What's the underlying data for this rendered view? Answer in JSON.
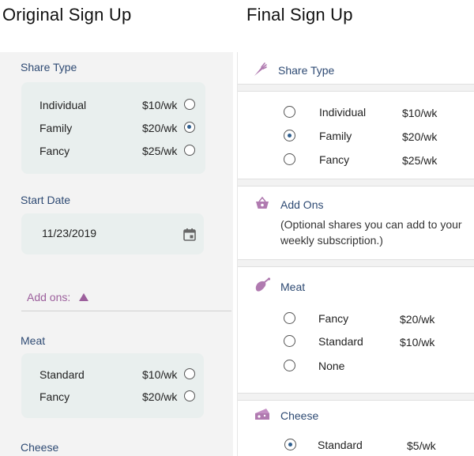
{
  "headings": {
    "original": "Original Sign Up",
    "final": "Final  Sign Up"
  },
  "original": {
    "share_type": {
      "label": "Share Type",
      "options": [
        {
          "name": "Individual",
          "price": "$10/wk",
          "selected": false
        },
        {
          "name": "Family",
          "price": "$20/wk",
          "selected": true
        },
        {
          "name": "Fancy",
          "price": "$25/wk",
          "selected": false
        }
      ]
    },
    "start_date": {
      "label": "Start Date",
      "value": "11/23/2019",
      "icon": "calendar-icon"
    },
    "addons_toggle": {
      "label": "Add ons:",
      "icon": "caret-up-icon"
    },
    "meat": {
      "label": "Meat",
      "options": [
        {
          "name": "Standard",
          "price": "$10/wk",
          "selected": false
        },
        {
          "name": "Fancy",
          "price": "$20/wk",
          "selected": false
        }
      ]
    },
    "cheese": {
      "label": "Cheese"
    }
  },
  "final": {
    "share_type": {
      "label": "Share Type",
      "icon": "carrot-icon",
      "options": [
        {
          "name": "Individual",
          "price": "$10/wk",
          "selected": false
        },
        {
          "name": "Family",
          "price": "$20/wk",
          "selected": true
        },
        {
          "name": "Fancy",
          "price": "$25/wk",
          "selected": false
        }
      ]
    },
    "add_ons": {
      "label": "Add Ons",
      "icon": "basket-icon",
      "description": "(Optional shares you can add to your weekly subscription.)"
    },
    "meat": {
      "label": "Meat",
      "icon": "meat-icon",
      "options": [
        {
          "name": "Fancy",
          "price": "$20/wk",
          "selected": false
        },
        {
          "name": "Standard",
          "price": "$10/wk",
          "selected": false
        },
        {
          "name": "None",
          "price": "",
          "selected": false
        }
      ]
    },
    "cheese": {
      "label": "Cheese",
      "icon": "cheese-icon",
      "options": [
        {
          "name": "Standard",
          "price": "$5/wk",
          "selected": true
        }
      ]
    }
  },
  "colors": {
    "title_blue": "#2e4a73",
    "accent_purple": "#9c5f9c",
    "box_bg": "#e9efee",
    "radio_fill": "#2f5f8f"
  }
}
